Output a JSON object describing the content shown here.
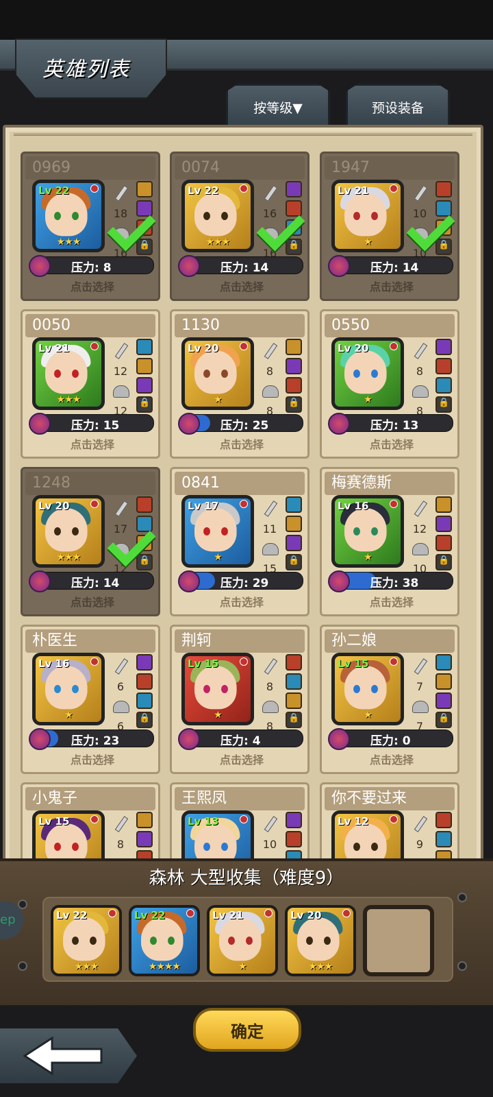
{
  "header": {
    "title": "英雄列表",
    "sort_label": "按等级▼",
    "preset_label": "预设装备"
  },
  "select_label": "点击选择",
  "pressure_prefix": "压力: ",
  "heroes": [
    {
      "id": "0969",
      "lv": "Lv 22",
      "lv_green": true,
      "frame": "blue",
      "hair": "#c66a2a",
      "eyes": "#2e8a2e",
      "attack": "18",
      "defense": "16",
      "stars": "★★★",
      "pressure": "压力: 8",
      "pressure_fill": 0,
      "dim": true,
      "checked": true
    },
    {
      "id": "0074",
      "lv": "Lv 22",
      "lv_green": false,
      "frame": "gold",
      "hair": "#e3b83a",
      "eyes": "#3a2a12",
      "attack": "16",
      "defense": "16",
      "stars": "★★★",
      "pressure": "压力: 14",
      "pressure_fill": 0,
      "dim": true,
      "checked": true
    },
    {
      "id": "1947",
      "lv": "Lv 21",
      "lv_green": false,
      "frame": "gold",
      "hair": "#d9d9e4",
      "eyes": "#b52a2a",
      "attack": "10",
      "defense": "10",
      "stars": "★",
      "pressure": "压力: 14",
      "pressure_fill": 0,
      "dim": true,
      "checked": true
    },
    {
      "id": "0050",
      "lv": "Lv 21",
      "lv_green": false,
      "frame": "green",
      "hair": "#eeeeee",
      "eyes": "#c22222",
      "attack": "12",
      "defense": "12",
      "stars": "★★★",
      "pressure": "压力: 15",
      "pressure_fill": 0,
      "dim": false,
      "checked": false
    },
    {
      "id": "1130",
      "lv": "Lv 20",
      "lv_green": false,
      "frame": "gold",
      "hair": "#f0a24c",
      "eyes": "#8a4a2a",
      "attack": "8",
      "defense": "8",
      "stars": "★",
      "pressure": "压力: 25",
      "pressure_fill": 0.25,
      "dim": false,
      "checked": false
    },
    {
      "id": "0550",
      "lv": "Lv 20",
      "lv_green": false,
      "frame": "green",
      "hair": "#5ad2a8",
      "eyes": "#2a7ad2",
      "attack": "8",
      "defense": "8",
      "stars": "★",
      "pressure": "压力: 13",
      "pressure_fill": 0,
      "dim": false,
      "checked": false
    },
    {
      "id": "1248",
      "lv": "Lv 20",
      "lv_green": false,
      "frame": "gold",
      "hair": "#2f6f78",
      "eyes": "#3a2a12",
      "attack": "17",
      "defense": "12",
      "stars": "★★★",
      "pressure": "压力: 14",
      "pressure_fill": 0,
      "dim": true,
      "checked": true
    },
    {
      "id": "0841",
      "lv": "Lv 17",
      "lv_green": false,
      "frame": "blue",
      "hair": "#c9c9c9",
      "eyes": "#c22222",
      "attack": "11",
      "defense": "15",
      "stars": "★",
      "pressure": "压力: 29",
      "pressure_fill": 0.29,
      "dim": false,
      "checked": false
    },
    {
      "id": "梅赛德斯",
      "lv": "Lv 16",
      "lv_green": false,
      "frame": "green",
      "hair": "#2a2e3a",
      "eyes": "#2a8a5a",
      "attack": "12",
      "defense": "10",
      "stars": "★",
      "pressure": "压力: 38",
      "pressure_fill": 0.38,
      "dim": false,
      "checked": false
    },
    {
      "id": "朴医生",
      "lv": "Lv 16",
      "lv_green": false,
      "frame": "gold",
      "hair": "#b7b0c8",
      "eyes": "#2a8ad2",
      "attack": "6",
      "defense": "6",
      "stars": "★",
      "pressure": "压力: 23",
      "pressure_fill": 0.23,
      "dim": false,
      "checked": false
    },
    {
      "id": "荆轲",
      "lv": "Lv 15",
      "lv_green": true,
      "frame": "red",
      "hair": "#9bb45a",
      "eyes": "#c22266",
      "attack": "8",
      "defense": "8",
      "stars": "★",
      "pressure": "压力: 4",
      "pressure_fill": 0,
      "dim": false,
      "checked": false
    },
    {
      "id": "孙二娘",
      "lv": "Lv 15",
      "lv_green": true,
      "frame": "gold",
      "hair": "#b8623a",
      "eyes": "#2a7ad2",
      "attack": "7",
      "defense": "7",
      "stars": "★",
      "pressure": "压力: 0",
      "pressure_fill": 0,
      "dim": false,
      "checked": false
    },
    {
      "id": "小鬼子",
      "lv": "Lv 15",
      "lv_green": false,
      "frame": "gold",
      "hair": "#5a2a7a",
      "eyes": "#c22222",
      "attack": "8",
      "defense": "",
      "stars": "",
      "pressure": "",
      "pressure_fill": 0,
      "dim": false,
      "checked": false
    },
    {
      "id": "王熙凤",
      "lv": "Lv 13",
      "lv_green": true,
      "frame": "blue",
      "hair": "#f1d59a",
      "eyes": "#2a7ad2",
      "attack": "10",
      "defense": "",
      "stars": "",
      "pressure": "",
      "pressure_fill": 0,
      "dim": false,
      "checked": false
    },
    {
      "id": "你不要过来",
      "lv": "Lv 12",
      "lv_green": false,
      "frame": "gold",
      "hair": "#f2b04a",
      "eyes": "#3a2a12",
      "attack": "9",
      "defense": "",
      "stars": "",
      "pressure": "",
      "pressure_fill": 0,
      "dim": false,
      "checked": false
    }
  ],
  "mission": {
    "title": "森林 大型收集（难度9）"
  },
  "team": [
    {
      "lv": "Lv 22",
      "lv_green": false,
      "frame": "gold",
      "hair": "#e3b83a",
      "eyes": "#3a2a12",
      "stars": "★★★"
    },
    {
      "lv": "Lv 22",
      "lv_green": true,
      "frame": "blue",
      "hair": "#c66a2a",
      "eyes": "#2e8a2e",
      "stars": "★★★★"
    },
    {
      "lv": "Lv 21",
      "lv_green": false,
      "frame": "gold",
      "hair": "#d9d9e4",
      "eyes": "#b52a2a",
      "stars": "★"
    },
    {
      "lv": "Lv 20",
      "lv_green": false,
      "frame": "gold",
      "hair": "#2f6f78",
      "eyes": "#3a2a12",
      "stars": "★★★"
    }
  ],
  "confirm_label": "确定",
  "colors": {
    "panel": "#d8c9a6",
    "accent": "#ffd95a",
    "pressure_bar": "#2d6bd0"
  }
}
